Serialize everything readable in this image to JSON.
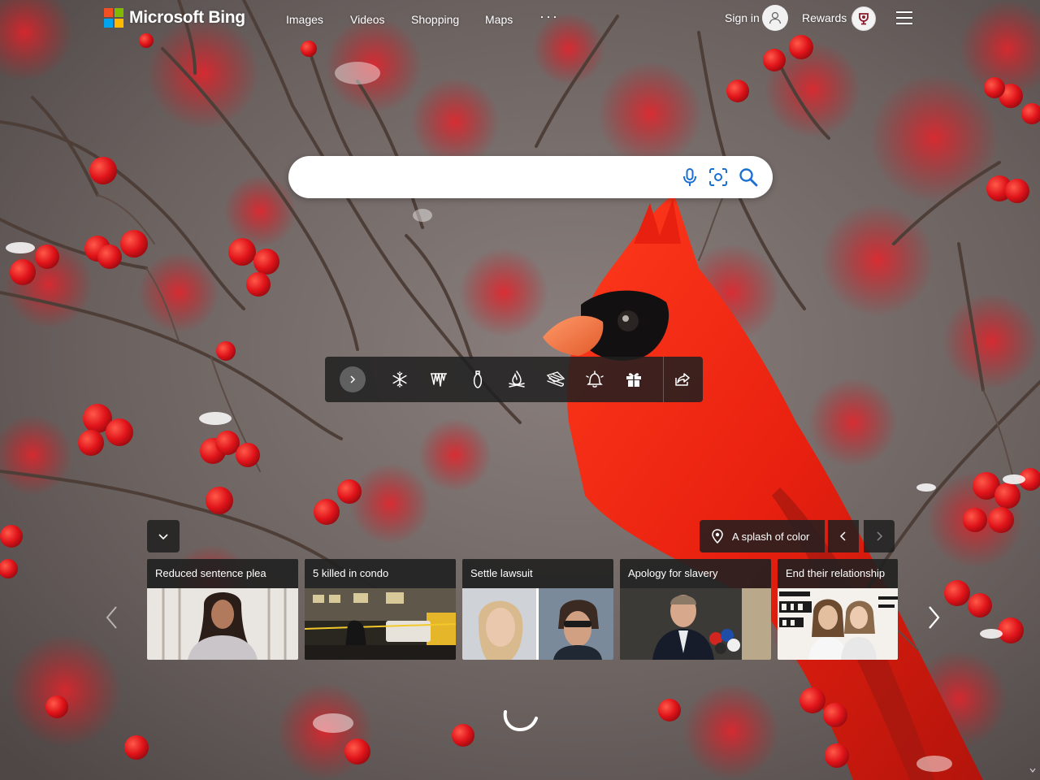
{
  "brand": {
    "name": "Microsoft Bing",
    "logo_colors": [
      "#f25022",
      "#7fba00",
      "#00a4ef",
      "#ffb900"
    ]
  },
  "nav": {
    "items": [
      {
        "label": "Images"
      },
      {
        "label": "Videos"
      },
      {
        "label": "Shopping"
      },
      {
        "label": "Maps"
      }
    ],
    "more_label": "···"
  },
  "account": {
    "signin_label": "Sign in",
    "rewards_label": "Rewards"
  },
  "search": {
    "value": "",
    "placeholder": "",
    "accent_color": "#1b6fd1"
  },
  "toolbar": {
    "icons": [
      "chevron-right-icon",
      "snowflake-icon",
      "icicles-icon",
      "ornament-icon",
      "fire-icon",
      "sled-icon",
      "bell-icon",
      "gift-icon",
      "share-icon"
    ]
  },
  "image_info": {
    "location_label": "A splash of color"
  },
  "news": {
    "cards": [
      {
        "title": "Reduced sentence plea"
      },
      {
        "title": "5 killed in condo"
      },
      {
        "title": "Settle lawsuit"
      },
      {
        "title": "Apology for slavery"
      },
      {
        "title": "End their relationship"
      }
    ]
  }
}
